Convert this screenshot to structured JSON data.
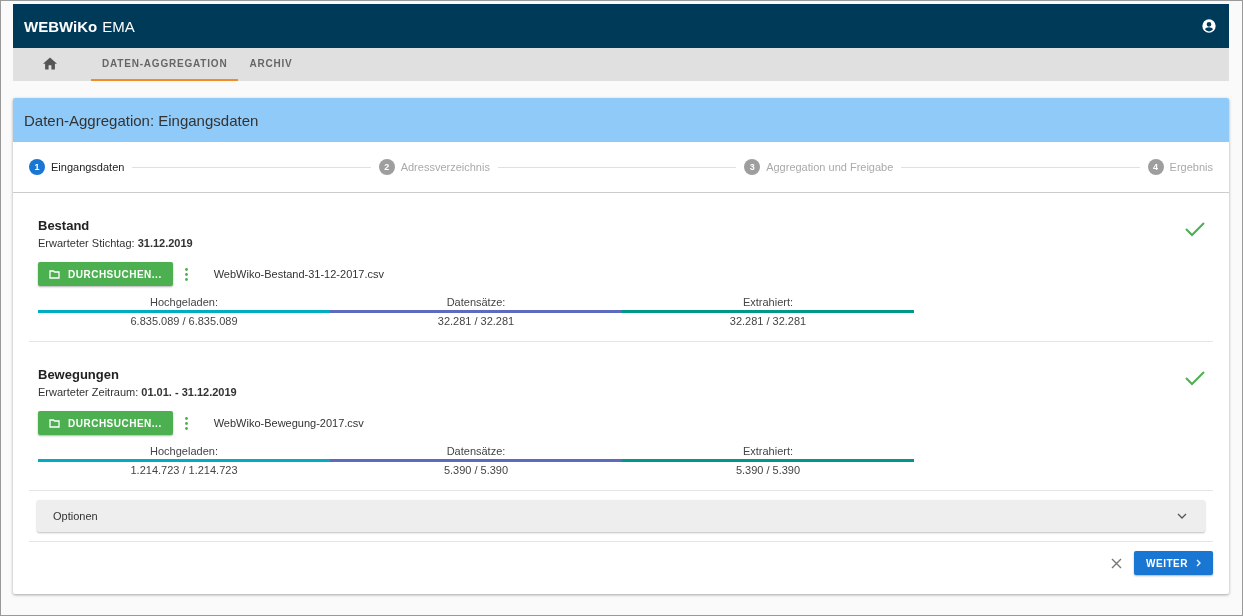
{
  "app_bar": {
    "brand": "WEBWiKo",
    "product": "EMA"
  },
  "nav_tabs": [
    {
      "kind": "home",
      "selected": false
    },
    {
      "kind": "text",
      "label": "DATEN-AGGREGATION",
      "selected": true
    },
    {
      "kind": "text",
      "label": "ARCHIV",
      "selected": false
    }
  ],
  "card": {
    "title": "Daten-Aggregation: Eingangsdaten",
    "steps": [
      {
        "number": "1",
        "label": "Eingangsdaten",
        "selected": true
      },
      {
        "number": "2",
        "label": "Adressverzeichnis",
        "selected": false
      },
      {
        "number": "3",
        "label": "Aggregation und Freigabe",
        "selected": false
      },
      {
        "number": "4",
        "label": "Ergebnis",
        "selected": false
      }
    ],
    "sections": [
      {
        "title": "Bestand",
        "hint": "Erwarteter Stichtag: **31.12.2019**",
        "complete": true,
        "browse_label": "DURCHSUCHEN...",
        "file": "WebWiko-Bestand-31-12-2017.csv",
        "stats": [
          {
            "label": "Hochgeladen:",
            "value": "6.835.089 / 6.835.089",
            "color": "#00acc1",
            "level": 1
          },
          {
            "label": "Datensätze:",
            "value": "32.281 / 32.281",
            "color": "#5c6bc0",
            "level": 1
          },
          {
            "label": "Extrahiert:",
            "value": "32.281 / 32.281",
            "color": "#009688",
            "level": 1
          }
        ]
      },
      {
        "title": "Bewegungen",
        "hint": "Erwarteter Zeitraum: **01.01. - 31.12.2019**",
        "complete": true,
        "browse_label": "DURCHSUCHEN...",
        "file": "WebWiko-Bewegung-2017.csv",
        "stats": [
          {
            "label": "Hochgeladen:",
            "value": "1.214.723 / 1.214.723",
            "color": "#00acc1",
            "level": 1
          },
          {
            "label": "Datensätze:",
            "value": "5.390 / 5.390",
            "color": "#5c6bc0",
            "level": 1
          },
          {
            "label": "Extrahiert:",
            "value": "5.390 / 5.390",
            "color": "#009688",
            "level": 1
          }
        ]
      }
    ],
    "options": {
      "label": "Optionen",
      "expanded": false
    },
    "next_button": "WEITER"
  }
}
